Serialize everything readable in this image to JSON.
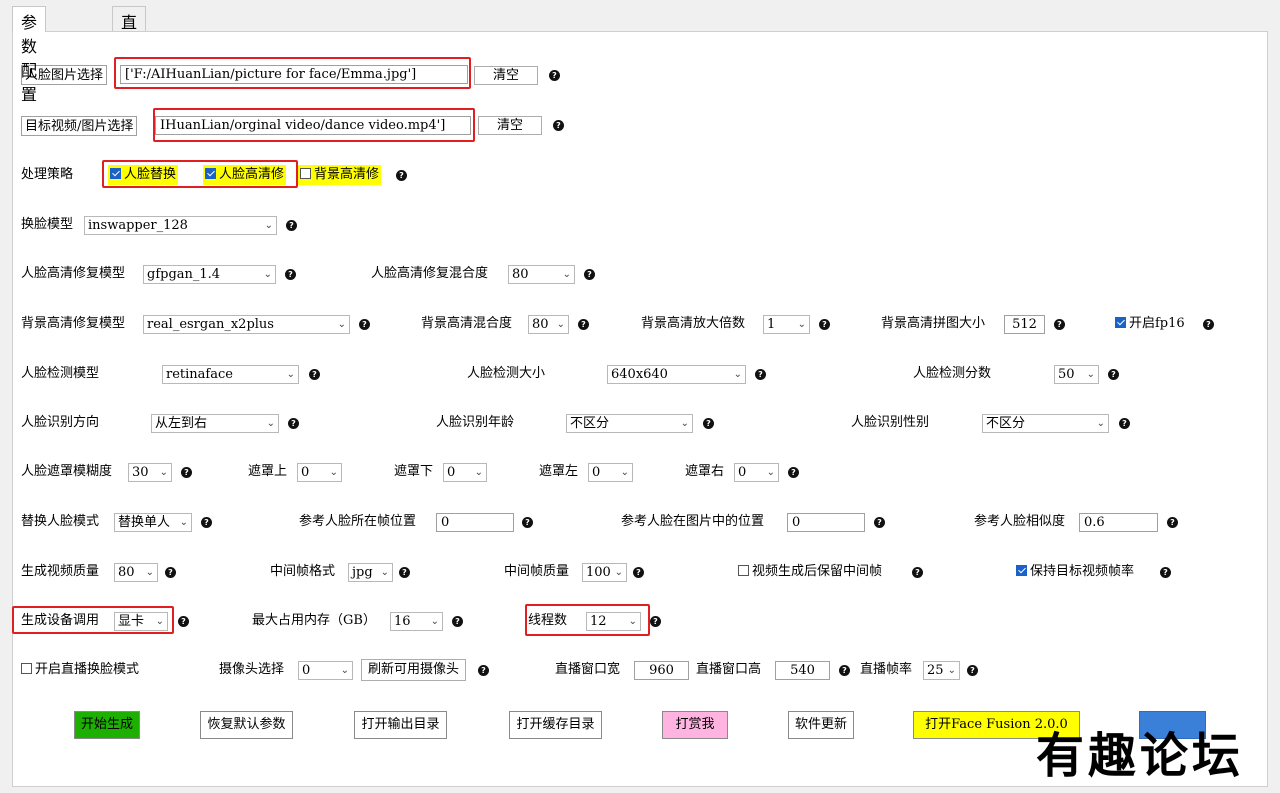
{
  "tabs": [
    "参数配置",
    "直播窗口"
  ],
  "face_image": {
    "label": "人脸图片选择",
    "value": "['F:/AIHuanLian/picture for face/Emma.jpg']",
    "clear": "清空"
  },
  "target": {
    "label": "目标视频/图片选择",
    "value": "IHuanLian/orginal video/dance video.mp4']",
    "clear": "清空"
  },
  "strategy": {
    "label": "处理策略",
    "options": [
      {
        "label": "人脸替换",
        "checked": true
      },
      {
        "label": "人脸高清修",
        "checked": true
      },
      {
        "label": "背景高清修",
        "checked": false
      }
    ]
  },
  "swap_model": {
    "label": "换脸模型",
    "value": "inswapper_128"
  },
  "face_enhance": {
    "label": "人脸高清修复模型",
    "value": "gfpgan_1.4",
    "blend_label": "人脸高清修复混合度",
    "blend_value": "80"
  },
  "bg_enhance": {
    "label": "背景高清修复模型",
    "value": "real_esrgan_x2plus",
    "blend_label": "背景高清混合度",
    "blend_value": "80",
    "scale_label": "背景高清放大倍数",
    "scale_value": "1",
    "tile_label": "背景高清拼图大小",
    "tile_value": "512",
    "fp16_label": "开启fp16",
    "fp16_checked": true
  },
  "detect": {
    "model_label": "人脸检测模型",
    "model_value": "retinaface",
    "size_label": "人脸检测大小",
    "size_value": "640x640",
    "score_label": "人脸检测分数",
    "score_value": "50"
  },
  "recog": {
    "dir_label": "人脸识别方向",
    "dir_value": "从左到右",
    "age_label": "人脸识别年龄",
    "age_value": "不区分",
    "gender_label": "人脸识别性别",
    "gender_value": "不区分"
  },
  "mask": {
    "blur_label": "人脸遮罩模糊度",
    "blur_value": "30",
    "top_label": "遮罩上",
    "top_value": "0",
    "bottom_label": "遮罩下",
    "bottom_value": "0",
    "left_label": "遮罩左",
    "left_value": "0",
    "right_label": "遮罩右",
    "right_value": "0"
  },
  "replace": {
    "mode_label": "替换人脸模式",
    "mode_value": "替换单人",
    "frame_pos_label": "参考人脸所在帧位置",
    "frame_pos_value": "0",
    "img_pos_label": "参考人脸在图片中的位置",
    "img_pos_value": "0",
    "sim_label": "参考人脸相似度",
    "sim_value": "0.6"
  },
  "output": {
    "quality_label": "生成视频质量",
    "quality_value": "80",
    "fmt_label": "中间帧格式",
    "fmt_value": "jpg",
    "fq_label": "中间帧质量",
    "fq_value": "100",
    "keep_label": "视频生成后保留中间帧",
    "keep_checked": false,
    "fps_label": "保持目标视频帧率",
    "fps_checked": true
  },
  "device": {
    "label": "生成设备调用",
    "value": "显卡",
    "mem_label": "最大占用内存（GB）",
    "mem_value": "16",
    "threads_label": "线程数",
    "threads_value": "12"
  },
  "live": {
    "toggle_label": "开启直播换脸模式",
    "toggle_checked": false,
    "cam_label": "摄像头选择",
    "cam_value": "0",
    "refresh": "刷新可用摄像头",
    "w_label": "直播窗口宽",
    "w_value": "960",
    "h_label": "直播窗口高",
    "h_value": "540",
    "fps_label": "直播帧率",
    "fps_value": "25"
  },
  "buttons": {
    "start": "开始生成",
    "reset": "恢复默认参数",
    "out_dir": "打开输出目录",
    "cache_dir": "打开缓存目录",
    "donate": "打赏我",
    "update": "软件更新",
    "facefusion": "打开Face Fusion 2.0.0",
    "blue": ""
  },
  "watermark": "有趣论坛",
  "help": "?",
  "arrow": "⌄",
  "colors": {
    "start": "#1db000",
    "donate": "#ffb3e0",
    "facefusion": "#ffff00",
    "blue": "#3a7fd8",
    "red_box": "#e02020"
  }
}
